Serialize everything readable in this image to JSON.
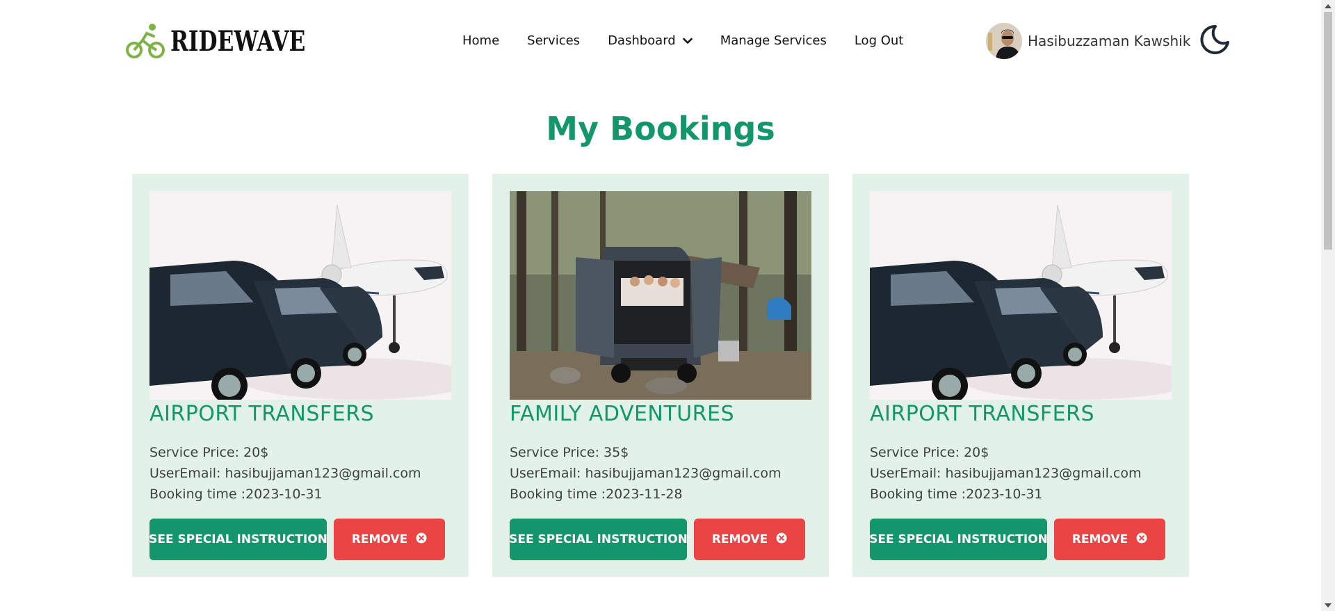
{
  "brand": {
    "name": "RIDEWAVE",
    "logo_icon": "cyclist-icon",
    "accent": "#8bc34a"
  },
  "nav": {
    "items": [
      {
        "label": "Home"
      },
      {
        "label": "Services"
      },
      {
        "label": "Dashboard"
      },
      {
        "label": "Manage Services"
      },
      {
        "label": "Log Out"
      }
    ]
  },
  "user": {
    "name": "Hasibuzzaman Kawshik",
    "theme_icon": "moon-icon"
  },
  "page": {
    "title": "My Bookings"
  },
  "colors": {
    "primary": "#13966b",
    "danger": "#ea4444",
    "card_bg": "#e2f2e9"
  },
  "bookings": [
    {
      "title": "AIRPORT TRANSFERS",
      "price": "Service Price: 20$",
      "email": "UserEmail: hasibujjaman123@gmail.com",
      "time": "Booking time :2023-10-31",
      "instruction_label": "SEE SPECIAL INSTRUCTION",
      "remove_label": "REMOVE",
      "image": "cars-and-private-jet-image"
    },
    {
      "title": "FAMILY ADVENTURES",
      "price": "Service Price: 35$",
      "email": "UserEmail: hasibujjaman123@gmail.com",
      "time": "Booking time :2023-11-28",
      "instruction_label": "SEE SPECIAL INSTRUCTION",
      "remove_label": "REMOVE",
      "image": "camper-van-forest-image"
    },
    {
      "title": "AIRPORT TRANSFERS",
      "price": "Service Price: 20$",
      "email": "UserEmail: hasibujjaman123@gmail.com",
      "time": "Booking time :2023-10-31",
      "instruction_label": "SEE SPECIAL INSTRUCTION",
      "remove_label": "REMOVE",
      "image": "cars-and-private-jet-image"
    }
  ]
}
